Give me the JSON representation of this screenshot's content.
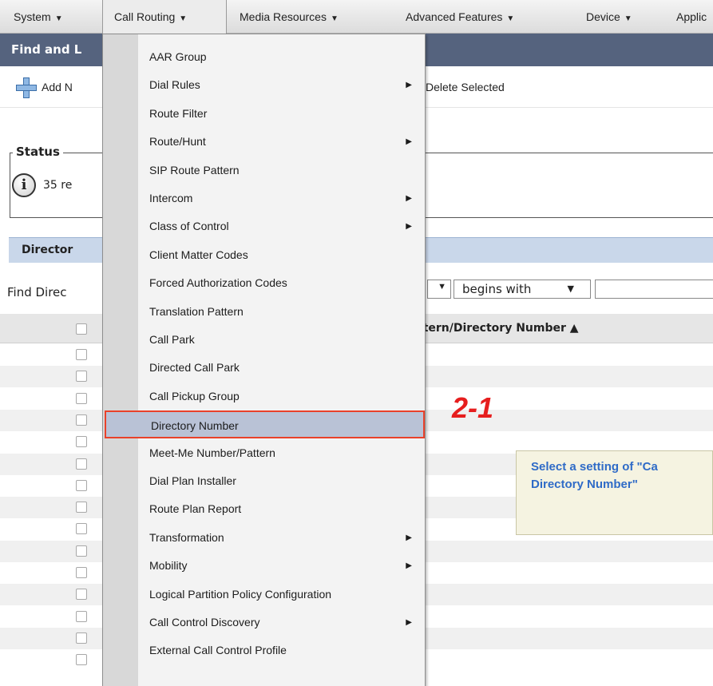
{
  "menubar": {
    "items": [
      {
        "label": "System"
      },
      {
        "label": "Call Routing"
      },
      {
        "label": "Media Resources"
      },
      {
        "label": "Advanced Features"
      },
      {
        "label": "Device"
      },
      {
        "label": "Applic"
      }
    ]
  },
  "title": {
    "text": "Find and L"
  },
  "toolbar": {
    "add_new": "Add N",
    "delete_selected": "Delete Selected"
  },
  "status": {
    "legend": "Status",
    "text": "35 re"
  },
  "section": {
    "title": "Director"
  },
  "find": {
    "label": "Find Direc",
    "operator": "begins with",
    "value": ""
  },
  "table": {
    "column_header": "ttern/Directory Number",
    "row_count": 15
  },
  "dropdown": {
    "items": [
      {
        "label": "AAR Group",
        "submenu": false
      },
      {
        "label": "Dial Rules",
        "submenu": true
      },
      {
        "label": "Route Filter",
        "submenu": false
      },
      {
        "label": "Route/Hunt",
        "submenu": true
      },
      {
        "label": "SIP Route Pattern",
        "submenu": false
      },
      {
        "label": "Intercom",
        "submenu": true
      },
      {
        "label": "Class of Control",
        "submenu": true
      },
      {
        "label": "Client Matter Codes",
        "submenu": false
      },
      {
        "label": "Forced Authorization Codes",
        "submenu": false
      },
      {
        "label": "Translation Pattern",
        "submenu": false
      },
      {
        "label": "Call Park",
        "submenu": false
      },
      {
        "label": "Directed Call Park",
        "submenu": false
      },
      {
        "label": "Call Pickup Group",
        "submenu": false
      },
      {
        "label": "Directory Number",
        "submenu": false,
        "highlighted": true
      },
      {
        "label": "Meet-Me Number/Pattern",
        "submenu": false
      },
      {
        "label": "Dial Plan Installer",
        "submenu": false
      },
      {
        "label": "Route Plan Report",
        "submenu": false
      },
      {
        "label": "Transformation",
        "submenu": true
      },
      {
        "label": "Mobility",
        "submenu": true
      },
      {
        "label": "Logical Partition Policy Configuration",
        "submenu": false
      },
      {
        "label": "Call Control Discovery",
        "submenu": true
      },
      {
        "label": "External Call Control Profile",
        "submenu": false
      }
    ]
  },
  "annotation": {
    "step_label": "2-1",
    "callout_line1": "Select a setting of \"Ca",
    "callout_line2": "Directory Number\""
  },
  "colors": {
    "title_bar": "#55637e",
    "highlight_border": "#e9412a",
    "annotation_red": "#e61e1e",
    "callout_text": "#2f6bc7"
  }
}
